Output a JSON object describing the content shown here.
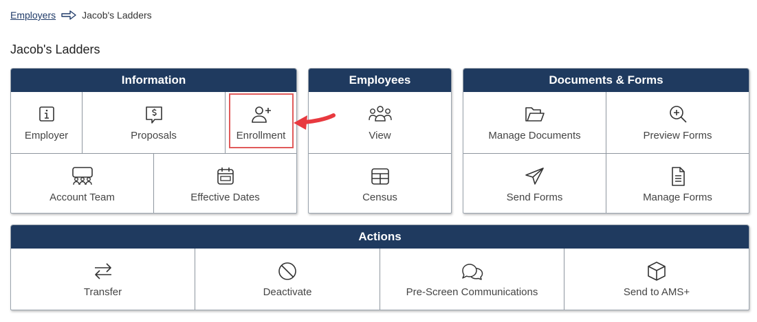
{
  "breadcrumb": {
    "parent": "Employers",
    "current": "Jacob's Ladders"
  },
  "page_title": "Jacob's Ladders",
  "colors": {
    "header_bg": "#1f3a5f",
    "highlight": "#e05a5a",
    "link": "#1f3a68"
  },
  "information": {
    "title": "Information",
    "tiles": [
      {
        "label": "Employer",
        "icon": "info-icon"
      },
      {
        "label": "Proposals",
        "icon": "dollar-chat-icon"
      },
      {
        "label": "Enrollment",
        "icon": "user-plus-icon"
      },
      {
        "label": "Account Team",
        "icon": "team-icon"
      },
      {
        "label": "Effective Dates",
        "icon": "calendar-icon"
      }
    ]
  },
  "employees": {
    "title": "Employees",
    "tiles": [
      {
        "label": "View",
        "icon": "users-icon"
      },
      {
        "label": "Census",
        "icon": "table-icon"
      }
    ]
  },
  "documents": {
    "title": "Documents & Forms",
    "tiles": [
      {
        "label": "Manage Documents",
        "icon": "folder-icon"
      },
      {
        "label": "Preview Forms",
        "icon": "zoom-in-icon"
      },
      {
        "label": "Send Forms",
        "icon": "paper-plane-icon"
      },
      {
        "label": "Manage Forms",
        "icon": "document-icon"
      }
    ]
  },
  "actions": {
    "title": "Actions",
    "tiles": [
      {
        "label": "Transfer",
        "icon": "transfer-icon"
      },
      {
        "label": "Deactivate",
        "icon": "ban-icon"
      },
      {
        "label": "Pre-Screen Communications",
        "icon": "chat-bubbles-icon"
      },
      {
        "label": "Send to AMS+",
        "icon": "box-icon"
      }
    ]
  }
}
